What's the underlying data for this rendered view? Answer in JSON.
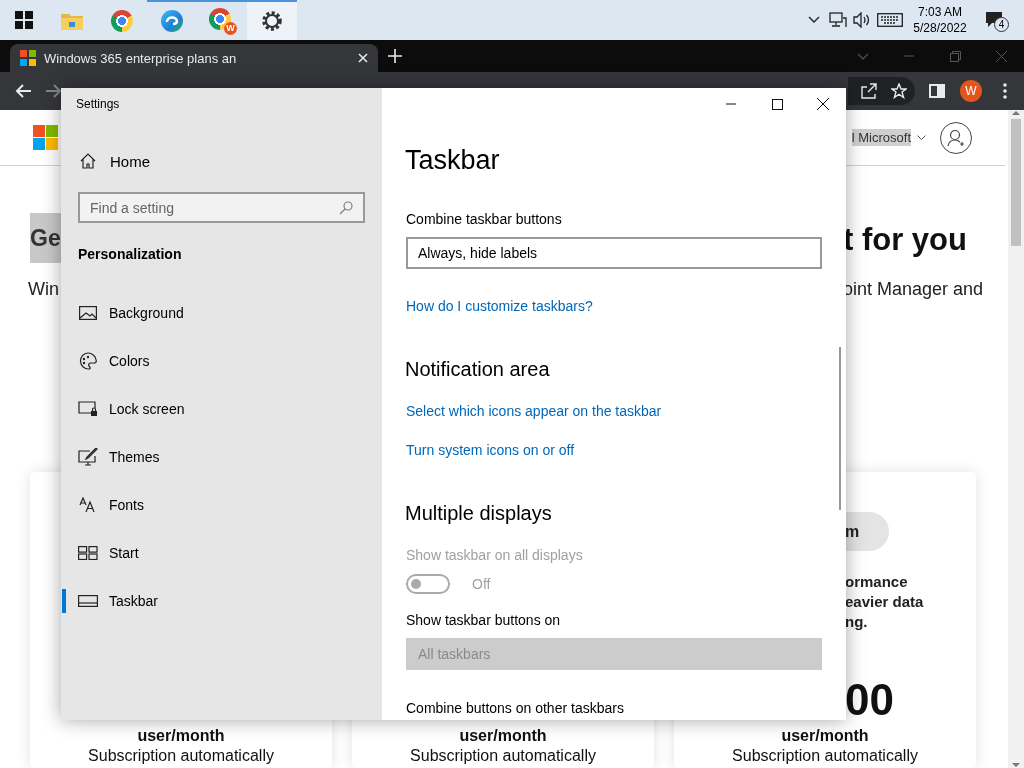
{
  "taskbar": {
    "apps": [
      {
        "kind": "folder",
        "running": false,
        "selected": false
      },
      {
        "kind": "chrome",
        "running": false,
        "selected": false
      },
      {
        "kind": "edge",
        "running": true,
        "selected": false
      },
      {
        "kind": "chrome-profile",
        "running": true,
        "selected": false,
        "badge": "W"
      },
      {
        "kind": "gear",
        "running": true,
        "selected": true
      }
    ],
    "tray": {
      "time": "7:03 AM",
      "date": "5/28/2022",
      "notification_count": "4"
    }
  },
  "browser": {
    "tab": {
      "title": "Windows 365 enterprise plans an",
      "selected": true
    },
    "profile_initial": "W",
    "page": {
      "account_label": "l Microsoft",
      "hero": {
        "heading_left": "Ge",
        "heading_right": "t for you",
        "text_left": "Win",
        "text_right": "oint Manager and"
      },
      "cards": [
        {
          "unit": "user/month",
          "note": "Subscription automatically"
        },
        {
          "unit": "user/month",
          "note": "Subscription automatically"
        },
        {
          "button": "m",
          "description": [
            "ormance",
            "eavier data",
            "ng."
          ],
          "price": "00",
          "unit": "user/month",
          "note": "Subscription automatically"
        }
      ]
    }
  },
  "settings": {
    "title": "Settings",
    "home": "Home",
    "search": {
      "placeholder": "Find a setting"
    },
    "section": "Personalization",
    "nav": [
      {
        "kind": "background",
        "label": "Background",
        "selected": false
      },
      {
        "kind": "colors",
        "label": "Colors",
        "selected": false
      },
      {
        "kind": "lock",
        "label": "Lock screen",
        "selected": false
      },
      {
        "kind": "themes",
        "label": "Themes",
        "selected": false
      },
      {
        "kind": "fonts",
        "label": "Fonts",
        "selected": false
      },
      {
        "kind": "start",
        "label": "Start",
        "selected": false
      },
      {
        "kind": "taskbar",
        "label": "Taskbar",
        "selected": true
      }
    ],
    "page_title": "Taskbar",
    "content": [
      {
        "kind": "label",
        "text": "Combine taskbar buttons",
        "disabled": false
      },
      {
        "kind": "dropdown",
        "value": "Always, hide labels",
        "disabled": false
      },
      {
        "kind": "link",
        "text": "How do I customize taskbars?"
      },
      {
        "kind": "heading",
        "text": "Notification area"
      },
      {
        "kind": "link",
        "text": "Select which icons appear on the taskbar"
      },
      {
        "kind": "link",
        "text": "Turn system icons on or off"
      },
      {
        "kind": "heading",
        "text": "Multiple displays"
      },
      {
        "kind": "label",
        "text": "Show taskbar on all displays",
        "disabled": true
      },
      {
        "kind": "toggle",
        "on": false,
        "state_label": "Off",
        "disabled": true
      },
      {
        "kind": "label",
        "text": "Show taskbar buttons on",
        "disabled": false
      },
      {
        "kind": "dropdown",
        "value": "All taskbars",
        "disabled": true
      },
      {
        "kind": "label",
        "text": "Combine buttons on other taskbars",
        "disabled": false
      }
    ]
  }
}
